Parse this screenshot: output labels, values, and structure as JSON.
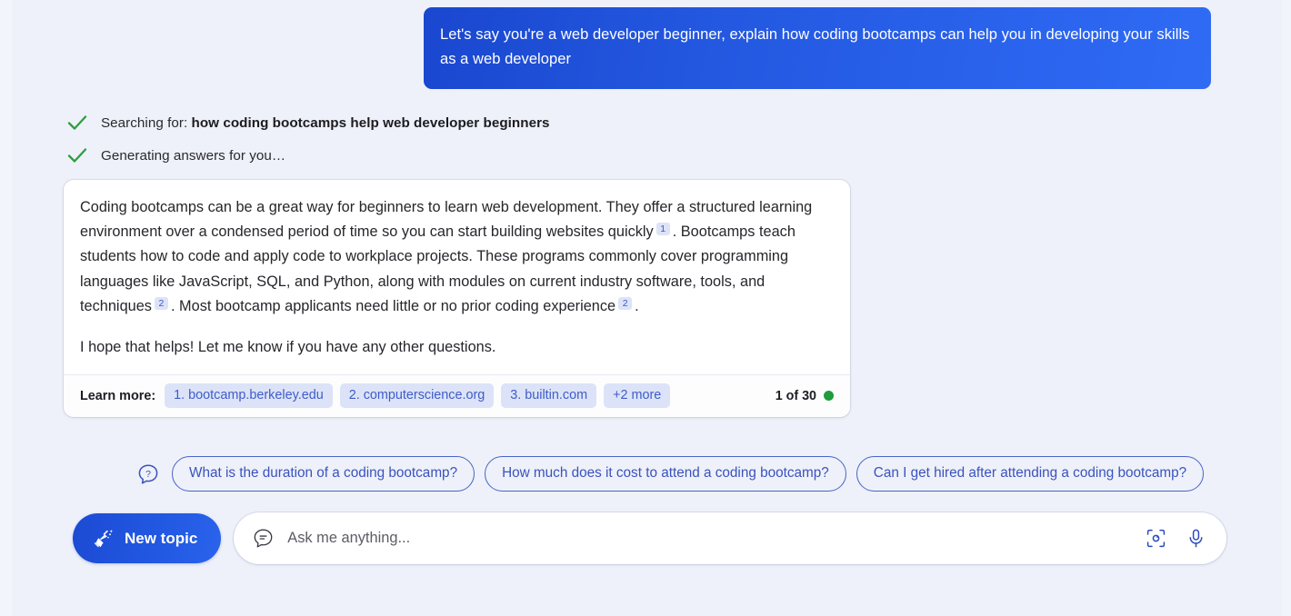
{
  "conversation": {
    "user_message": "Let's say you're a web developer beginner, explain how coding bootcamps can help you in developing your skills as a web developer",
    "status": [
      {
        "icon": "check-icon",
        "prefix": "Searching for: ",
        "query": "how coding bootcamps help web developer beginners"
      },
      {
        "icon": "check-icon",
        "prefix": "Generating answers for you…",
        "query": ""
      }
    ],
    "answer": {
      "paragraph1_part1": "Coding bootcamps can be a great way for beginners to learn web development. They offer a structured learning environment over a condensed period of time so you can start building websites quickly",
      "cite1": "1",
      "paragraph1_part2": ". Bootcamps teach students how to code and apply code to workplace projects. These programs commonly cover programming languages like JavaScript, SQL, and Python, along with modules on current industry software, tools, and techniques",
      "cite2": "2",
      "paragraph1_part3": ". Most bootcamp applicants need little or no prior coding experience",
      "cite3": "2",
      "paragraph1_part4": ".",
      "paragraph2": "I hope that helps! Let me know if you have any other questions."
    },
    "footer": {
      "learn_more_label": "Learn more:",
      "sources": [
        "1. bootcamp.berkeley.edu",
        "2. computerscience.org",
        "3. builtin.com",
        "+2 more"
      ],
      "page_count": "1 of 30",
      "status_dot_color": "#1f9c3c"
    }
  },
  "suggestions": {
    "icon": "question-bubble-icon",
    "chips": [
      "What is the duration of a coding bootcamp?",
      "How much does it cost to attend a coding bootcamp?",
      "Can I get hired after attending a coding bootcamp?"
    ]
  },
  "composer": {
    "new_topic_label": "New topic",
    "new_topic_icon": "broom-icon",
    "input_icon": "chat-bubble-icon",
    "input_value": "",
    "input_placeholder": "Ask me anything...",
    "camera_icon": "visual-search-icon",
    "mic_icon": "microphone-icon"
  },
  "colors": {
    "accent_blue": "#2259e2",
    "chip_blue": "#3f5cc9",
    "chip_bg": "#dce3f8",
    "check_green": "#2e9e3e",
    "page_bg": "#eef1f9"
  }
}
